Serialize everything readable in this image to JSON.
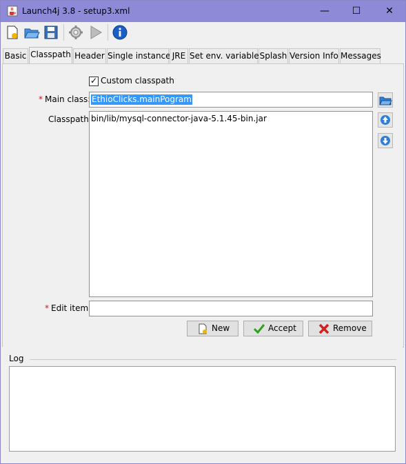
{
  "window": {
    "title": "Launch4j 3.8 - setup3.xml",
    "controls": {
      "minimize": "—",
      "maximize": "☐",
      "close": "✕"
    }
  },
  "toolbar": {
    "icons": [
      "new-config-icon",
      "open-folder-icon",
      "save-icon",
      "build-wrapper-icon",
      "run-icon",
      "about-icon"
    ]
  },
  "tabs": [
    "Basic",
    "Classpath",
    "Header",
    "Single instance",
    "JRE",
    "Set env. variables",
    "Splash",
    "Version Info",
    "Messages"
  ],
  "active_tab": "Classpath",
  "classpath": {
    "custom_classpath_label": "Custom classpath",
    "custom_classpath_checked": true,
    "required_mark": "*",
    "main_class_label": "Main class:",
    "main_class_value": "EthioClicks.mainPogram",
    "classpath_label": "Classpath:",
    "classpath_items": [
      "bin/lib/mysql-connector-java-5.1.45-bin.jar"
    ],
    "edit_item_label": "Edit item:",
    "edit_item_value": "",
    "buttons": {
      "new": "New",
      "accept": "Accept",
      "remove": "Remove"
    }
  },
  "log": {
    "title": "Log",
    "content": ""
  },
  "colors": {
    "titlebar": "#8e8ad8",
    "selection": "#3399ff",
    "required": "#d21010",
    "icon_blue": "#1f6fd1"
  }
}
